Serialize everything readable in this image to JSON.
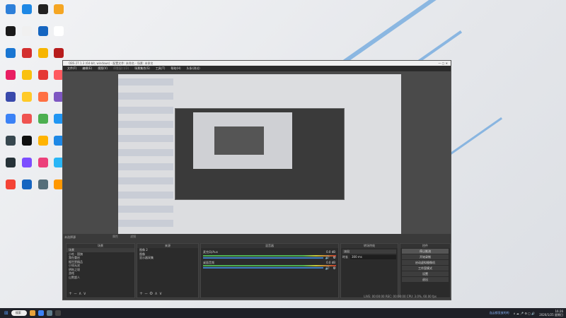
{
  "desktop": {
    "icon_colors": [
      "#2d7fd9",
      "#1e88e5",
      "#222",
      "#f5a623",
      "#1a1a1a",
      "#f0f0f0",
      "#1565c0",
      "#ffffff",
      "#1976d2",
      "#d32f2f",
      "#f7b500",
      "#b71c1c",
      "#e91e63",
      "#f9c10e",
      "#e53935",
      "#ff5a5f",
      "#3949ab",
      "#ffca28",
      "#ff7043",
      "#7e57c2",
      "#3b82f6",
      "#ef5350",
      "#4caf50",
      "#2196f3",
      "#37474f",
      "#0f0f0f",
      "#ffb300",
      "#1e88e5",
      "#263238",
      "#7c4dff",
      "#ec407a",
      "#29b6f6",
      "#f44336",
      "#1565c0",
      "#546e7a",
      "#ff9800"
    ]
  },
  "obs": {
    "title": "OBS 27.1.3 (64-bit, windows) - 配置文件: 未命名 - 场景: 未命名",
    "menu": [
      "文件(F)",
      "编辑(E)",
      "视图(V)",
      "停靠窗口(D)",
      "场景集合(S)",
      "工具(T)",
      "帮助(H)",
      "头条(测试)"
    ],
    "preview_label": "未选择源",
    "props_label": "属性",
    "filters_label": "滤镜",
    "scenes": {
      "title": "场景",
      "items": [
        "场景",
        "小吃 - 国旗",
        "我在重启",
        "据世界精品",
        "小如无双",
        "明秋之境",
        "游戏",
        "山警超人"
      ]
    },
    "sources": {
      "title": "来源",
      "items": [
        "图像 2",
        "图像",
        "显示器采集"
      ]
    },
    "mixer": {
      "title": "混音器",
      "channels": [
        {
          "name": "麦克风/Aux",
          "db": "0.0 dB"
        },
        {
          "name": "桌面音频",
          "db": "0.0 dB"
        }
      ]
    },
    "transitions": {
      "title": "转场特效",
      "selected": "淡出",
      "duration_label": "时长",
      "duration": "300 ms"
    },
    "controls": {
      "title": "控件",
      "buttons": [
        "停止推流",
        "开始录制",
        "启动虚拟摄像机",
        "工作室模式",
        "设置",
        "退出"
      ]
    },
    "status": "LIVE: 00:00:00   REC: 00:00:00   CPU: 3.0%, 60.00 fps"
  },
  "taskbar": {
    "search": "搜索",
    "tray_text": "连云都显放的的",
    "time": "16:26",
    "date": "2026/1/25 星期日"
  }
}
